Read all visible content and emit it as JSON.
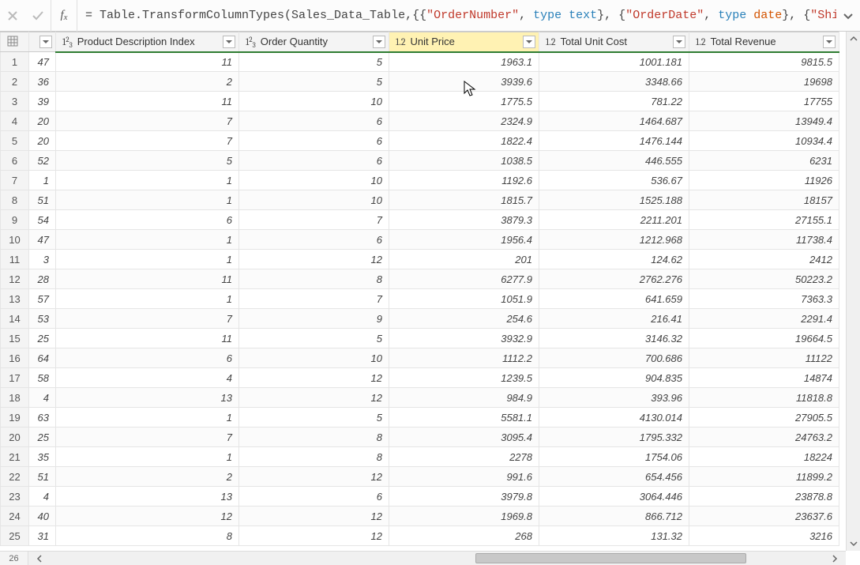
{
  "formula_bar": {
    "prefix": "= Table.TransformColumnTypes(Sales_Data_Table,{{",
    "s1": "\"OrderNumber\"",
    "mid1": ", ",
    "kw1": "type",
    "sp1": " ",
    "kw2": "text",
    "mid2": "}, {",
    "s2": "\"OrderDate\"",
    "mid3": ", ",
    "kw3": "type",
    "sp2": " ",
    "kw4": "date",
    "mid4": "}, {",
    "s3": "\"Ship Date\"",
    "tail": ","
  },
  "columns": [
    {
      "label": "Product Description Index",
      "type": "int"
    },
    {
      "label": "Order Quantity",
      "type": "int"
    },
    {
      "label": "Unit Price",
      "type": "dec",
      "selected": true
    },
    {
      "label": "Total Unit Cost",
      "type": "dec"
    },
    {
      "label": "Total Revenue",
      "type": "dec"
    }
  ],
  "index_values": [
    "47",
    "36",
    "39",
    "20",
    "20",
    "52",
    "1",
    "51",
    "54",
    "47",
    "3",
    "28",
    "57",
    "53",
    "25",
    "64",
    "58",
    "4",
    "63",
    "25",
    "35",
    "51",
    "4",
    "40",
    "31"
  ],
  "rows": [
    [
      "11",
      "5",
      "1963.1",
      "1001.181",
      "9815.5"
    ],
    [
      "2",
      "5",
      "3939.6",
      "3348.66",
      "19698"
    ],
    [
      "11",
      "10",
      "1775.5",
      "781.22",
      "17755"
    ],
    [
      "7",
      "6",
      "2324.9",
      "1464.687",
      "13949.4"
    ],
    [
      "7",
      "6",
      "1822.4",
      "1476.144",
      "10934.4"
    ],
    [
      "5",
      "6",
      "1038.5",
      "446.555",
      "6231"
    ],
    [
      "1",
      "10",
      "1192.6",
      "536.67",
      "11926"
    ],
    [
      "1",
      "10",
      "1815.7",
      "1525.188",
      "18157"
    ],
    [
      "6",
      "7",
      "3879.3",
      "2211.201",
      "27155.1"
    ],
    [
      "1",
      "6",
      "1956.4",
      "1212.968",
      "11738.4"
    ],
    [
      "1",
      "12",
      "201",
      "124.62",
      "2412"
    ],
    [
      "11",
      "8",
      "6277.9",
      "2762.276",
      "50223.2"
    ],
    [
      "1",
      "7",
      "1051.9",
      "641.659",
      "7363.3"
    ],
    [
      "7",
      "9",
      "254.6",
      "216.41",
      "2291.4"
    ],
    [
      "11",
      "5",
      "3932.9",
      "3146.32",
      "19664.5"
    ],
    [
      "6",
      "10",
      "1112.2",
      "700.686",
      "11122"
    ],
    [
      "4",
      "12",
      "1239.5",
      "904.835",
      "14874"
    ],
    [
      "13",
      "12",
      "984.9",
      "393.96",
      "11818.8"
    ],
    [
      "1",
      "5",
      "5581.1",
      "4130.014",
      "27905.5"
    ],
    [
      "7",
      "8",
      "3095.4",
      "1795.332",
      "24763.2"
    ],
    [
      "1",
      "8",
      "2278",
      "1754.06",
      "18224"
    ],
    [
      "2",
      "12",
      "991.6",
      "654.456",
      "11899.2"
    ],
    [
      "13",
      "6",
      "3979.8",
      "3064.446",
      "23878.8"
    ],
    [
      "12",
      "12",
      "1969.8",
      "866.712",
      "23637.6"
    ],
    [
      "8",
      "12",
      "268",
      "131.32",
      "3216"
    ]
  ],
  "last_row_label": "26"
}
